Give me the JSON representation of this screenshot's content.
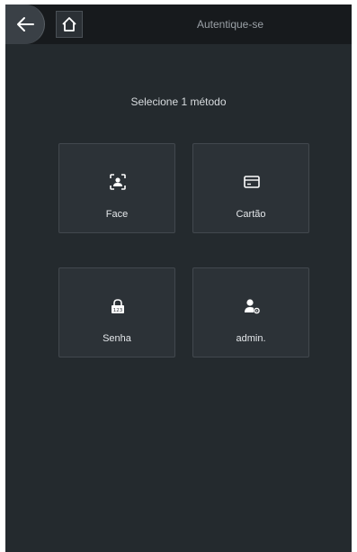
{
  "header": {
    "title": "Autentique-se",
    "back_icon": "back-arrow-icon",
    "home_icon": "home-icon"
  },
  "main": {
    "prompt": "Selecione 1 método",
    "methods": [
      {
        "label": "Face",
        "icon": "face-icon"
      },
      {
        "label": "Cartão",
        "icon": "card-icon"
      },
      {
        "label": "Senha",
        "icon": "password-lock-icon"
      },
      {
        "label": "admin.",
        "icon": "admin-user-icon"
      }
    ]
  },
  "colors": {
    "background": "#242a2e",
    "topbar": "#171a1d",
    "tile": "#2c3237",
    "text": "#e4e7ea"
  }
}
